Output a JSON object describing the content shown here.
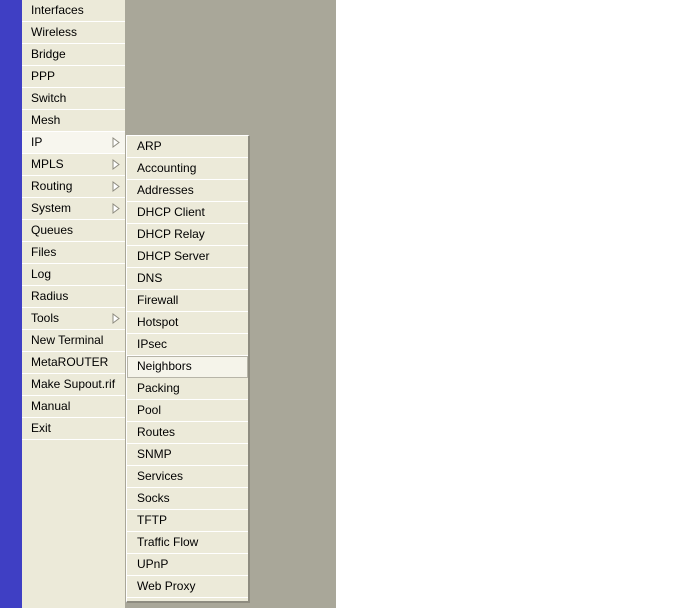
{
  "main_menu": {
    "items": [
      {
        "label": "Interfaces"
      },
      {
        "label": "Wireless"
      },
      {
        "label": "Bridge"
      },
      {
        "label": "PPP"
      },
      {
        "label": "Switch"
      },
      {
        "label": "Mesh"
      },
      {
        "label": "IP",
        "submenu_icon": "submenu-arrow-icon"
      },
      {
        "label": "MPLS",
        "submenu_icon": "submenu-arrow-icon"
      },
      {
        "label": "Routing",
        "submenu_icon": "submenu-arrow-icon"
      },
      {
        "label": "System",
        "submenu_icon": "submenu-arrow-icon"
      },
      {
        "label": "Queues"
      },
      {
        "label": "Files"
      },
      {
        "label": "Log"
      },
      {
        "label": "Radius"
      },
      {
        "label": "Tools",
        "submenu_icon": "submenu-arrow-icon"
      },
      {
        "label": "New Terminal"
      },
      {
        "label": "MetaROUTER"
      },
      {
        "label": "Make Supout.rif"
      },
      {
        "label": "Manual"
      },
      {
        "label": "Exit"
      }
    ],
    "active_item": "IP"
  },
  "ip_submenu": {
    "items": [
      {
        "label": "ARP"
      },
      {
        "label": "Accounting"
      },
      {
        "label": "Addresses"
      },
      {
        "label": "DHCP Client"
      },
      {
        "label": "DHCP Relay"
      },
      {
        "label": "DHCP Server"
      },
      {
        "label": "DNS"
      },
      {
        "label": "Firewall"
      },
      {
        "label": "Hotspot"
      },
      {
        "label": "IPsec"
      },
      {
        "label": "Neighbors"
      },
      {
        "label": "Packing"
      },
      {
        "label": "Pool"
      },
      {
        "label": "Routes"
      },
      {
        "label": "SNMP"
      },
      {
        "label": "Services"
      },
      {
        "label": "Socks"
      },
      {
        "label": "TFTP"
      },
      {
        "label": "Traffic Flow"
      },
      {
        "label": "UPnP"
      },
      {
        "label": "Web Proxy"
      }
    ],
    "hovered_item": "Neighbors"
  },
  "colors": {
    "side_stripe": "#3f3fc4",
    "menu_background": "#ecead9",
    "workspace_background": "#a9a799"
  }
}
